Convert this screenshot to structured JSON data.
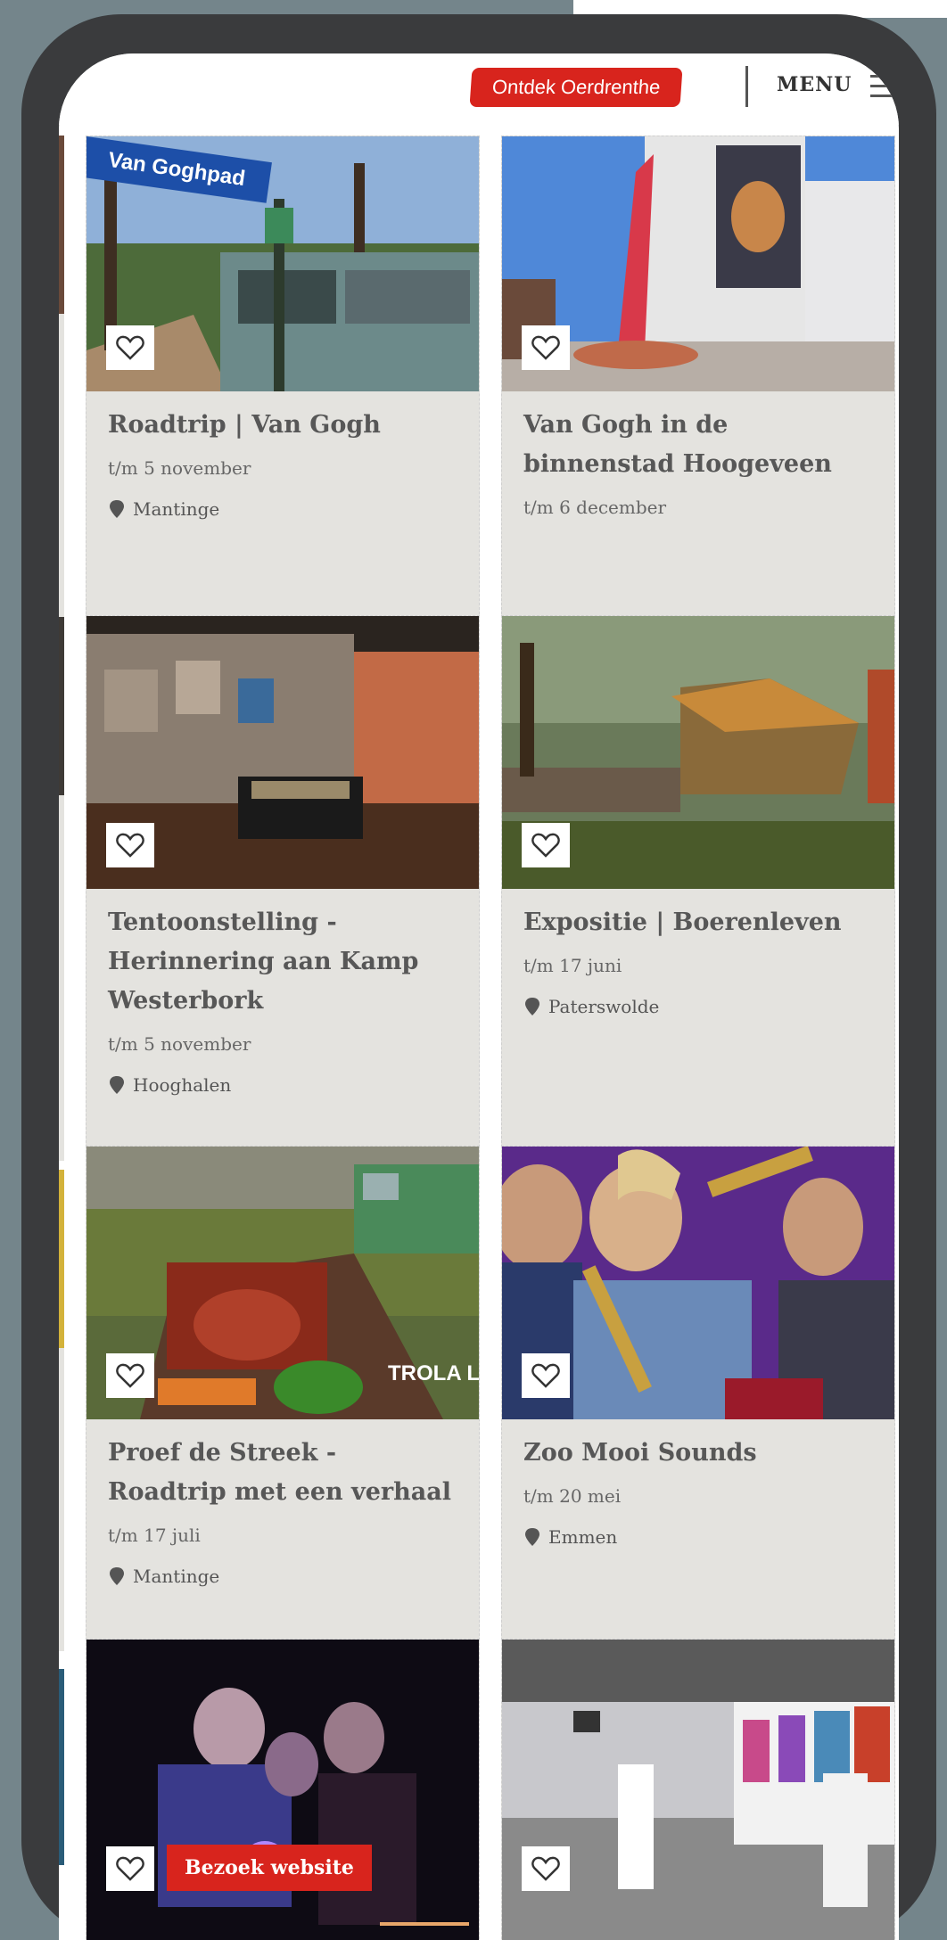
{
  "header": {
    "cta_label": "Ontdek Oerdrenthe",
    "menu_label": "MENU",
    "menu_icon": "hamburger-icon"
  },
  "colors": {
    "accent": "#d8241d",
    "card_bg": "#e4e3df",
    "frame": "#3a3b3d"
  },
  "cards": [
    {
      "title": "Roadtrip | Van Gogh",
      "date": "t/m 5 november",
      "location": "Mantinge",
      "sign_text": "Van Goghpad"
    },
    {
      "title": "Van Gogh in de binnenstad Hoogeveen",
      "date": "t/m 6 december"
    },
    {
      "title": "Tentoonstelling - Herinnering aan Kamp Westerbork",
      "date": "t/m 5 november",
      "location": "Hooghalen"
    },
    {
      "title": "Expositie | Boerenleven",
      "date": "t/m 17 juni",
      "location": "Paterswolde"
    },
    {
      "title": "Proef de Streek - Roadtrip met een verhaal",
      "date": "t/m 17 juli",
      "location": "Mantinge",
      "logo_text": "TROLA LUNA"
    },
    {
      "title": "Zoo Mooi Sounds",
      "date": "t/m 20 mei",
      "location": "Emmen"
    },
    {
      "button_label": "Bezoek website"
    },
    {}
  ]
}
